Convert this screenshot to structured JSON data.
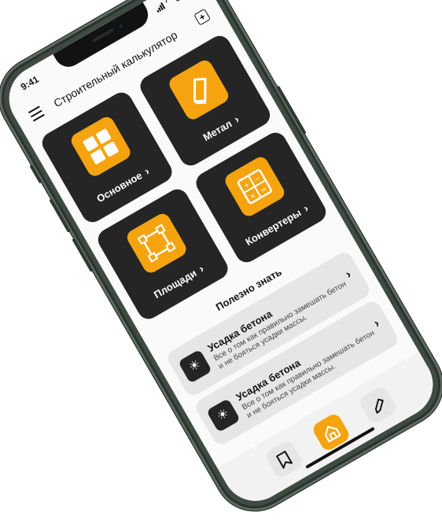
{
  "status_bar": {
    "time": "9:41"
  },
  "header": {
    "title": "Строительный калькулятор",
    "add_icon": "+"
  },
  "tiles": [
    {
      "label": "Основное",
      "icon": "grid-icon"
    },
    {
      "label": "Метал",
      "icon": "metal-icon"
    },
    {
      "label": "Площади",
      "icon": "area-icon"
    },
    {
      "label": "Конвертеры",
      "icon": "calculator-icon"
    }
  ],
  "section": {
    "title": "Полезно знать"
  },
  "articles": [
    {
      "title": "Усадка бетона",
      "text": "Все о том как правильно замешать бетон и не бояться усадки массы."
    },
    {
      "title": "Усадка бетона",
      "text": "Все о том как правильно замешать бетон и не бояться усадки массы."
    }
  ],
  "chevron": "›",
  "tabbar": {
    "bookmark_icon": "bookmark-icon",
    "home_icon": "home-icon",
    "edit_icon": "pencil-icon"
  },
  "colors": {
    "accent": "#f5a40f",
    "tile_bg": "#252525",
    "frame": "#3f4a43"
  }
}
